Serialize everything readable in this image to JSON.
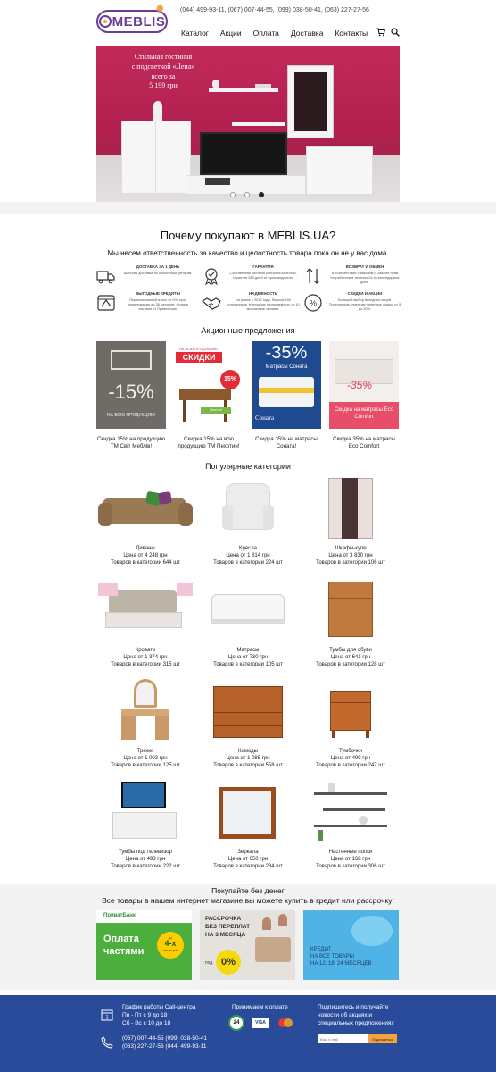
{
  "header": {
    "logo_text": "MEBLIS",
    "phones": "(044) 499-93-11, (067) 007-44-55, (099) 038-50-41, (063) 227-27-56",
    "nav": [
      "Каталог",
      "Акции",
      "Оплата",
      "Доставка",
      "Контакты"
    ],
    "icons": [
      "cart-icon",
      "search-icon"
    ]
  },
  "hero": {
    "line1": "Стильная гостиная",
    "line2": "с подсветкой «Лена»",
    "line3": "всего за",
    "line4": "5 199 грн",
    "slides": 3,
    "active_slide": 3
  },
  "why": {
    "title": "Почему покупают в MEBLIS.UA?",
    "subtitle": "Мы несем ответственность за качество и целостность товара пока он не у вас дома.",
    "features": [
      {
        "title": "ДОСТАВКА ЗА 1 ДЕНЬ",
        "text": "Быстрая доставка по областным центрам.",
        "icon": "truck-icon"
      },
      {
        "title": "ГАРАНТИЯ",
        "text": "Собственная система контроля качества, гарантия 365 дней от производителя.",
        "icon": "warranty-icon"
      },
      {
        "title": "ВОЗВРАТ И ОБМЕН",
        "text": "В соответствии с законом о Защите прав потребителя в течении 14-ти календарных дней.",
        "icon": "exchange-icon"
      },
      {
        "title": "ВЫГОДНЫЕ КРЕДИТЫ",
        "text": "Первоначальный взнос от 0%, срок кредитования до 36 месяцев. Оплата частями от ПриватБанк.",
        "icon": "credit-icon"
      },
      {
        "title": "НАДЕЖНОСТЬ",
        "text": "На рынке с 2012 года, больше 100 сотрудников, ежегодная посещаемость от 10 миллионов человек.",
        "icon": "handshake-icon"
      },
      {
        "title": "СКИДКИ И АКЦИИ",
        "text": "Большой выбор выгодных акций. Постоянным клиентам приятные скидки от 5 до 30%.",
        "icon": "percent-icon"
      }
    ]
  },
  "promos": {
    "title": "Акционные предложения",
    "items": [
      {
        "caption": "Скидка 15% на продукцию ТМ Світ Меблів!",
        "big": "-15%",
        "small": "НА ВСЮ ПРОДУКЦИЮ"
      },
      {
        "caption": "Скидка 15% на всю продукцию ТМ Пехотин!",
        "big": "СКИДКИ",
        "small": "НА ВСЮ ПРОДУКЦИЮ",
        "badge": "15%",
        "brand": "Пехотин"
      },
      {
        "caption": "Скидка 35% на матрасы Соната!",
        "big": "-35%",
        "small": "Матрасы Соната",
        "brand": "Соната"
      },
      {
        "caption": "Скидка 35% на матрасы Eco Comfort",
        "big": "-35%",
        "small": "Скидка на матрасы Eco Comfort"
      }
    ]
  },
  "categories": {
    "title": "Популярные категории",
    "items": [
      {
        "name": "Диваны",
        "price": "Цена от 4 248  грн",
        "count": "Товаров в категории 644 шт"
      },
      {
        "name": "Кресла",
        "price": "Цена от 1 814 грн",
        "count": "Товаров в категории 224 шт"
      },
      {
        "name": "Шкафы-купе",
        "price": "Цена от 3 830 грн",
        "count": "Товаров в категории 106 шт"
      },
      {
        "name": "Кровати",
        "price": "Цена от 1 374 грн",
        "count": "Товаров в категории 315 шт"
      },
      {
        "name": "Матрасы",
        "price": "Цена от 730  грн",
        "count": "Товаров в категории 105 шт"
      },
      {
        "name": "Тумбы для обуви",
        "price": "Цена от 641 грн",
        "count": "Товаров в категории 128 шт"
      },
      {
        "name": "Трюмо",
        "price": "Цена от 1 003 грн",
        "count": "Товаров в категории 125 шт"
      },
      {
        "name": "Комоды",
        "price": "Цена от 1 085 грн",
        "count": "Товаров в категории 558 шт"
      },
      {
        "name": "Тумбочки",
        "price": "Цена от 499 грн",
        "count": "Товаров в категории 247 шт"
      },
      {
        "name": "Тумбы под телевизор",
        "price": "Цена от 493 грн",
        "count": "Товаров в категории 222 шт"
      },
      {
        "name": "Зеркала",
        "price": "Цена от 650 грн",
        "count": "Товаров в категории 234 шт"
      },
      {
        "name": "Настенные полки",
        "price": "Цена от 168 грн",
        "count": "Товаров в категории 306 шт"
      }
    ]
  },
  "credit": {
    "title": "Покупайте без денег",
    "subtitle": "Все товары в нашем интернет магазине вы можете купить в кредит или рассрочку!",
    "card1": {
      "bank": "ПриватБанк",
      "line1": "Оплата",
      "line2": "частями",
      "badge_pre": "до",
      "badge_num": "4-х",
      "badge_post": "месяцев"
    },
    "card2": {
      "line1": "РАССРОЧКА",
      "line2": "БЕЗ ПЕРЕПЛАТ",
      "line3": "НА 3 МЕСЯЦА",
      "pod": "под",
      "rate": "0%"
    },
    "card3": {
      "line1": "КРЕДИТ",
      "line2": "НА ВСЕ ТОВАРЫ",
      "line3": "НА 12, 18, 24 МЕСЯЦЕВ"
    }
  },
  "footer": {
    "schedule_title": "График работы Call-центра",
    "schedule_1": "Пн - Пт с 9 до 18",
    "schedule_2": "Сб - Вс с 10 до 18",
    "phones_1": "(067) 007-44-55  (099) 038-50-41",
    "phones_2": "(063) 227-27-56  (044) 499-93-11",
    "payment_title": "Принимаем к оплате",
    "pay_24": "24",
    "pay_visa": "VISA",
    "subscribe_1": "Подпишитесь и получайте",
    "subscribe_2": "новости об акциях и",
    "subscribe_3": "специальных предложениях",
    "email_placeholder": "Ваш e-mail",
    "subscribe_button": "Подписаться"
  },
  "colors": {
    "brand_purple": "#6a3c97",
    "accent_orange": "#f2a33a",
    "footer_blue": "#2a4b9a",
    "hero_red": "#b1204f"
  }
}
